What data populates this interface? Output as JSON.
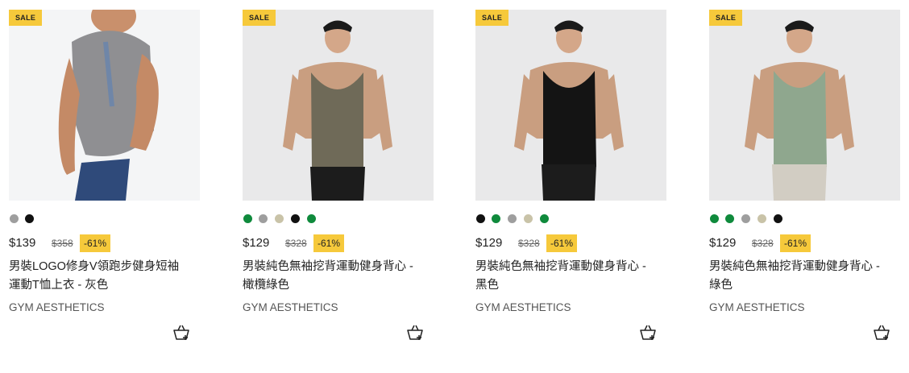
{
  "products": [
    {
      "badge": "SALE",
      "price": "$139",
      "old_price": "$358",
      "discount": "-61%",
      "title_line1": "男裝LOGO修身V領跑步健身短袖",
      "title_line2": "運動T恤上衣 - 灰色",
      "brand": "GYM AESTHETICS",
      "swatch_colors": [
        "#9e9e9e",
        "#111111"
      ],
      "cart_icon": "add-to-cart-icon"
    },
    {
      "badge": "SALE",
      "price": "$129",
      "old_price": "$328",
      "discount": "-61%",
      "title_line1": "男裝純色無袖挖背運動健身背心 -",
      "title_line2": "橄欖綠色",
      "brand": "GYM AESTHETICS",
      "swatch_colors": [
        "#0f8a3c",
        "#9e9e9e",
        "#c9c3a8",
        "#111111",
        "#0f8a3c"
      ],
      "cart_icon": "add-to-cart-icon"
    },
    {
      "badge": "SALE",
      "price": "$129",
      "old_price": "$328",
      "discount": "-61%",
      "title_line1": "男裝純色無袖挖背運動健身背心 -",
      "title_line2": "黑色",
      "brand": "GYM AESTHETICS",
      "swatch_colors": [
        "#111111",
        "#0f8a3c",
        "#9e9e9e",
        "#c9c3a8",
        "#0f8a3c"
      ],
      "cart_icon": "add-to-cart-icon"
    },
    {
      "badge": "SALE",
      "price": "$129",
      "old_price": "$328",
      "discount": "-61%",
      "title_line1": "男裝純色無袖挖背運動健身背心 -",
      "title_line2": "綠色",
      "brand": "GYM AESTHETICS",
      "swatch_colors": [
        "#0f8a3c",
        "#0f8a3c",
        "#9e9e9e",
        "#c9c3a8",
        "#111111"
      ],
      "cart_icon": "add-to-cart-icon"
    }
  ],
  "colors": {
    "sale_badge": "#f6c93b",
    "discount_badge": "#f6c93b"
  }
}
